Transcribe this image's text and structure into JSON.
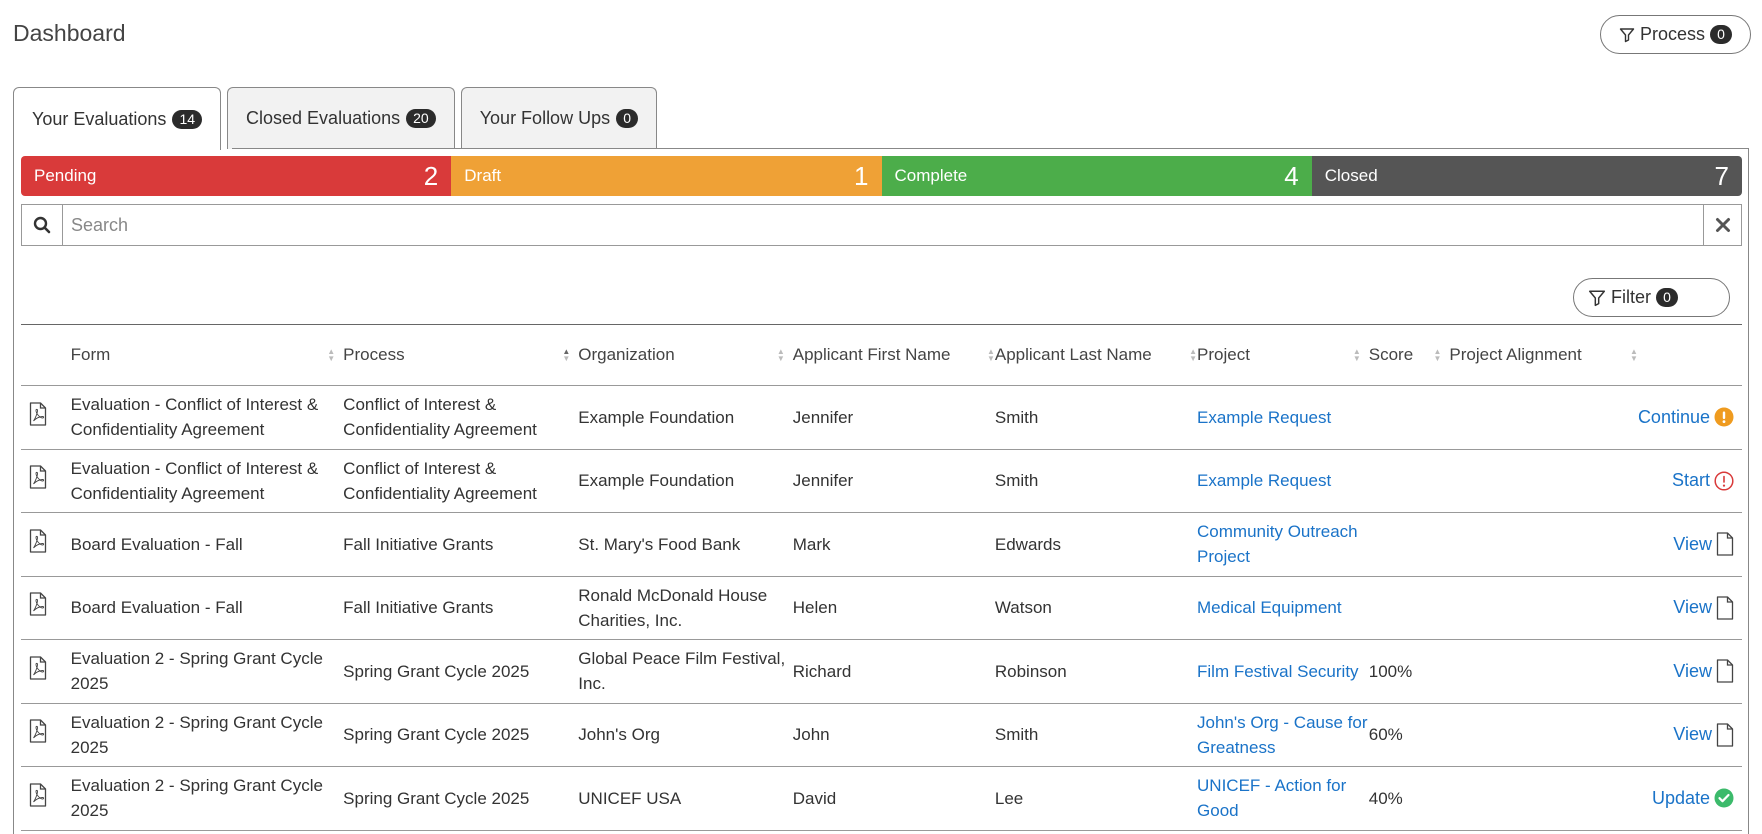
{
  "page_title": "Dashboard",
  "process_button": {
    "label": "Process",
    "count": "0"
  },
  "tabs": [
    {
      "label": "Your Evaluations",
      "count": "14"
    },
    {
      "label": "Closed Evaluations",
      "count": "20"
    },
    {
      "label": "Your Follow Ups",
      "count": "0"
    }
  ],
  "status": [
    {
      "label": "Pending",
      "count": "2",
      "color": "#d93a3a"
    },
    {
      "label": "Draft",
      "count": "1",
      "color": "#efa136"
    },
    {
      "label": "Complete",
      "count": "4",
      "color": "#4cad4a"
    },
    {
      "label": "Closed",
      "count": "7",
      "color": "#555555"
    }
  ],
  "search": {
    "placeholder": "Search"
  },
  "filter_button": {
    "label": "Filter",
    "count": "0"
  },
  "columns": [
    "Form",
    "Process",
    "Organization",
    "Applicant First Name",
    "Applicant Last Name",
    "Project",
    "Score",
    "Project Alignment"
  ],
  "rows": [
    {
      "form": "Evaluation - Conflict of Interest & Confidentiality Agreement",
      "process": "Conflict of Interest & Confidentiality Agreement",
      "organization": "Example Foundation",
      "first": "Jennifer",
      "last": "Smith",
      "project": "Example Request",
      "score": "",
      "alignment": "",
      "action": "Continue",
      "action_icon": "warning-filled-icon"
    },
    {
      "form": "Evaluation - Conflict of Interest & Confidentiality Agreement",
      "process": "Conflict of Interest & Confidentiality Agreement",
      "organization": "Example Foundation",
      "first": "Jennifer",
      "last": "Smith",
      "project": "Example Request",
      "score": "",
      "alignment": "",
      "action": "Start",
      "action_icon": "warning-outline-icon"
    },
    {
      "form": "Board Evaluation - Fall",
      "process": "Fall Initiative Grants",
      "organization": "St. Mary's Food Bank",
      "first": "Mark",
      "last": "Edwards",
      "project": "Community Outreach Project",
      "score": "",
      "alignment": "",
      "action": "View",
      "action_icon": "document-icon"
    },
    {
      "form": "Board Evaluation - Fall",
      "process": "Fall Initiative Grants",
      "organization": "Ronald McDonald House Charities, Inc.",
      "first": "Helen",
      "last": "Watson",
      "project": "Medical Equipment",
      "score": "",
      "alignment": "",
      "action": "View",
      "action_icon": "document-icon"
    },
    {
      "form": "Evaluation 2 - Spring Grant Cycle 2025",
      "process": "Spring Grant Cycle 2025",
      "organization": "Global Peace Film Festival, Inc.",
      "first": "Richard",
      "last": "Robinson",
      "project": "Film Festival Security",
      "score": "100%",
      "alignment": "",
      "action": "View",
      "action_icon": "document-icon"
    },
    {
      "form": "Evaluation 2 - Spring Grant Cycle 2025",
      "process": "Spring Grant Cycle 2025",
      "organization": "John's Org",
      "first": "John",
      "last": "Smith",
      "project": "John's Org - Cause for Greatness",
      "score": "60%",
      "alignment": "",
      "action": "View",
      "action_icon": "document-icon"
    },
    {
      "form": "Evaluation 2 - Spring Grant Cycle 2025",
      "process": "Spring Grant Cycle 2025",
      "organization": "UNICEF USA",
      "first": "David",
      "last": "Lee",
      "project": "UNICEF - Action for Good",
      "score": "40%",
      "alignment": "",
      "action": "Update",
      "action_icon": "check-circle-icon"
    }
  ]
}
